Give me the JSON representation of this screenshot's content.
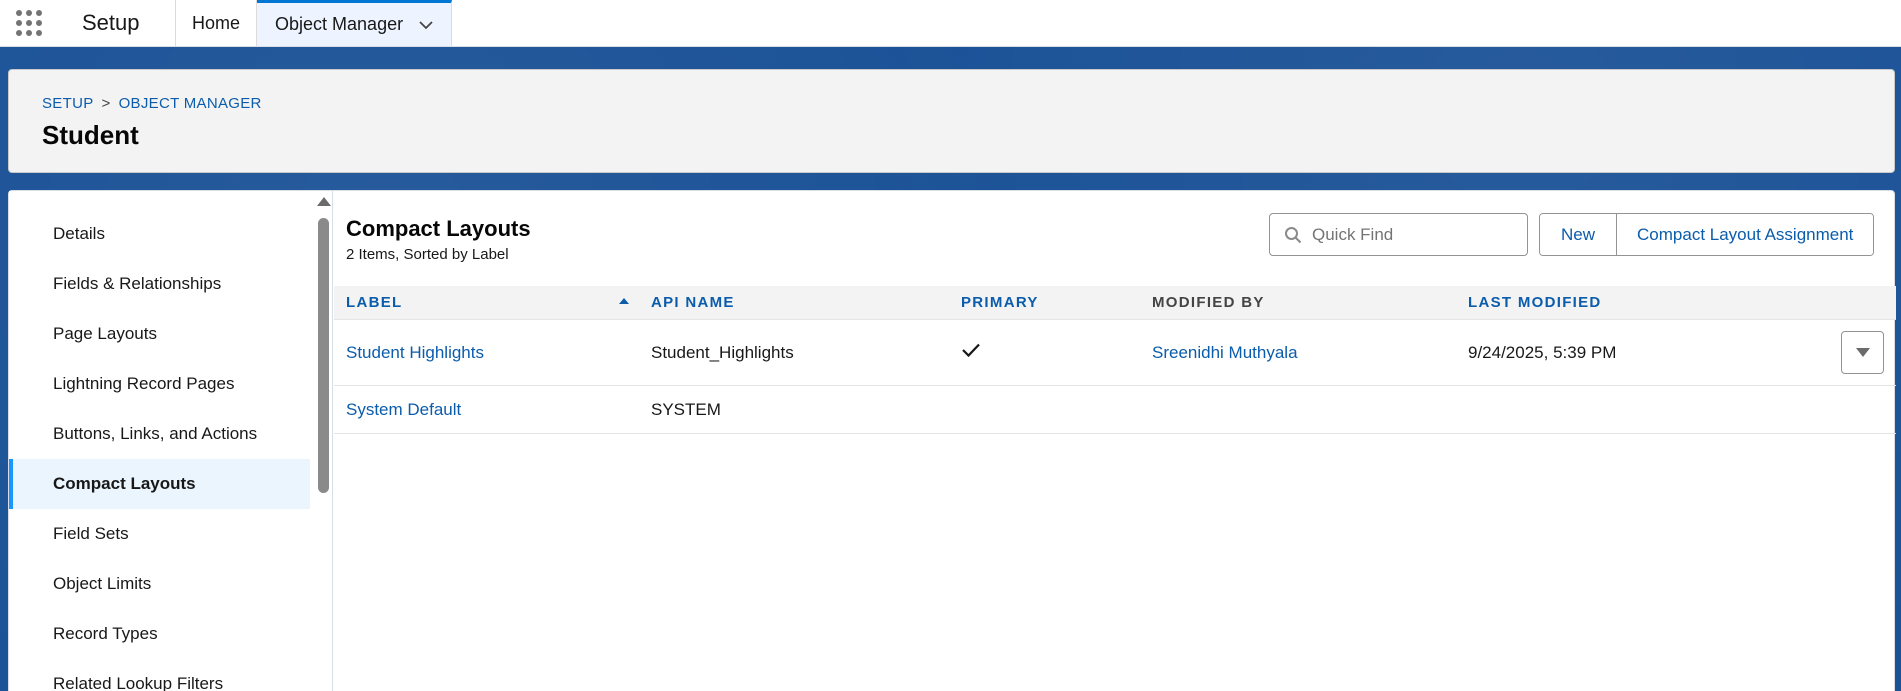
{
  "topnav": {
    "app_name": "Setup",
    "tabs": [
      {
        "label": "Home"
      },
      {
        "label": "Object Manager"
      }
    ]
  },
  "header": {
    "breadcrumb": [
      "SETUP",
      "OBJECT MANAGER"
    ],
    "breadcrumb_separator": ">",
    "title": "Student"
  },
  "sidebar": {
    "items": [
      {
        "label": "Details"
      },
      {
        "label": "Fields & Relationships"
      },
      {
        "label": "Page Layouts"
      },
      {
        "label": "Lightning Record Pages"
      },
      {
        "label": "Buttons, Links, and Actions"
      },
      {
        "label": "Compact Layouts"
      },
      {
        "label": "Field Sets"
      },
      {
        "label": "Object Limits"
      },
      {
        "label": "Record Types"
      },
      {
        "label": "Related Lookup Filters"
      }
    ],
    "active_index": 5
  },
  "content": {
    "title": "Compact Layouts",
    "subtitle": "2 Items, Sorted by Label",
    "search": {
      "placeholder": "Quick Find",
      "value": ""
    },
    "buttons": {
      "new": "New",
      "assignment": "Compact Layout Assignment"
    }
  },
  "table": {
    "columns": [
      "LABEL",
      "API NAME",
      "PRIMARY",
      "MODIFIED BY",
      "LAST MODIFIED"
    ],
    "rows": [
      {
        "label": "Student Highlights",
        "api_name": "Student_Highlights",
        "primary": true,
        "modified_by": "Sreenidhi Muthyala",
        "last_modified": "9/24/2025, 5:39 PM"
      },
      {
        "label": "System Default",
        "api_name": "SYSTEM",
        "primary": false,
        "modified_by": "",
        "last_modified": ""
      }
    ]
  },
  "colors": {
    "brand_blue": "#1b5297",
    "link": "#0b5cab",
    "active_accent": "#1b96ff"
  }
}
